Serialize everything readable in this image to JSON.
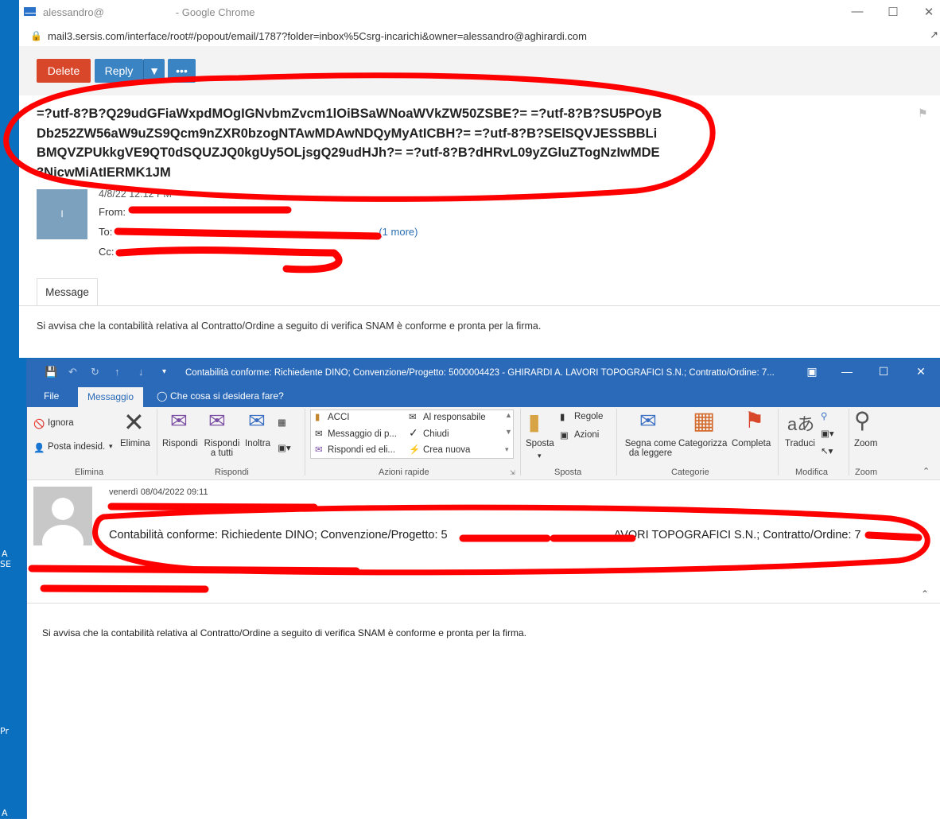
{
  "desktop": {
    "labels": [
      "A",
      "SE",
      "Pr",
      "A"
    ]
  },
  "chrome": {
    "window_title": "alessandro@",
    "window_title_suffix": "- Google Chrome",
    "url": "mail3.sersis.com/interface/root#/popout/email/1787?folder=inbox%5Csrg-incarichi&owner=alessandro@aghirardi.com",
    "toolbar": {
      "delete_label": "Delete",
      "reply_label": "Reply",
      "more_label": "•••"
    },
    "subject": "=?utf-8?B?Q29udGFiaWxpdMOgIGNvbmZvcm1lOiBSaWNoaWVkZW50ZSBE?= =?utf-8?B?SU5POyBDb252ZW56aW9uZS9Qcm9nZXR0bzogNTAwMDAwNDQyMyAtICBH?= =?utf-8?B?SElSQVJESSBBLiBMQVZPUkkgVE9QT0dSQUZJQ0kgUy5OLjsgQ29udHJh?= =?utf-8?B?dHRvL09yZGluZTogNzIwMDE3NjcwMiAtIERMK1JM",
    "avatar_initial": "I",
    "date": "4/8/22 12:12 PM",
    "from_label": "From:",
    "to_label": "To:",
    "to_more": "(1 more)",
    "cc_label": "Cc:",
    "tab_message": "Message",
    "body": "Si avvisa che la contabilità relativa al Contratto/Ordine a seguito di verifica SNAM è conforme e pronta per la firma."
  },
  "outlook": {
    "title": "Contabilità conforme: Richiedente DINO; Convenzione/Progetto: 5000004423 -  GHIRARDI A. LAVORI TOPOGRAFICI S.N.; Contratto/Ordine: 7...",
    "tabs": {
      "file": "File",
      "messaggio": "Messaggio",
      "tell_me": "Che cosa si desidera fare?"
    },
    "ribbon": {
      "ignora": "Ignora",
      "posta_indesid": "Posta indesid.",
      "elimina_btn": "Elimina",
      "group_elimina": "Elimina",
      "rispondi": "Rispondi",
      "rispondi_a_tutti_1": "Rispondi",
      "rispondi_a_tutti_2": "a tutti",
      "inoltra": "Inoltra",
      "group_rispondi": "Rispondi",
      "qs_acci": "ACCI",
      "qs_messaggio": "Messaggio di p...",
      "qs_rispondi_elimina": "Rispondi ed eli...",
      "qs_al_responsabile": "Al responsabile",
      "qs_chiudi": "Chiudi",
      "qs_crea_nuova": "Crea nuova",
      "group_azioni_rapide": "Azioni rapide",
      "sposta": "Sposta",
      "regole": "Regole",
      "azioni": "Azioni",
      "group_sposta": "Sposta",
      "segna_come_1": "Segna come",
      "segna_come_2": "da leggere",
      "categorizza": "Categorizza",
      "completa": "Completa",
      "group_categorie": "Categorie",
      "traduci": "Traduci",
      "group_modifica": "Modifica",
      "zoom": "Zoom",
      "group_zoom": "Zoom"
    },
    "message": {
      "date": "venerdì 08/04/2022 09:11",
      "subject": "Contabilità conforme: Richiedente DINO; Convenzione/Progetto: 5",
      "subject_tail": "AVORI TOPOGRAFICI S.N.; Contratto/Ordine: 7",
      "body": "Si avvisa che la contabilità relativa al Contratto/Ordine a seguito di verifica SNAM è conforme e pronta per la firma."
    }
  },
  "colors": {
    "delete_button": "#d9472b",
    "reply_button": "#3b84c4",
    "outlook_blue": "#2b6ab8",
    "annotation_red": "#ff0000"
  }
}
